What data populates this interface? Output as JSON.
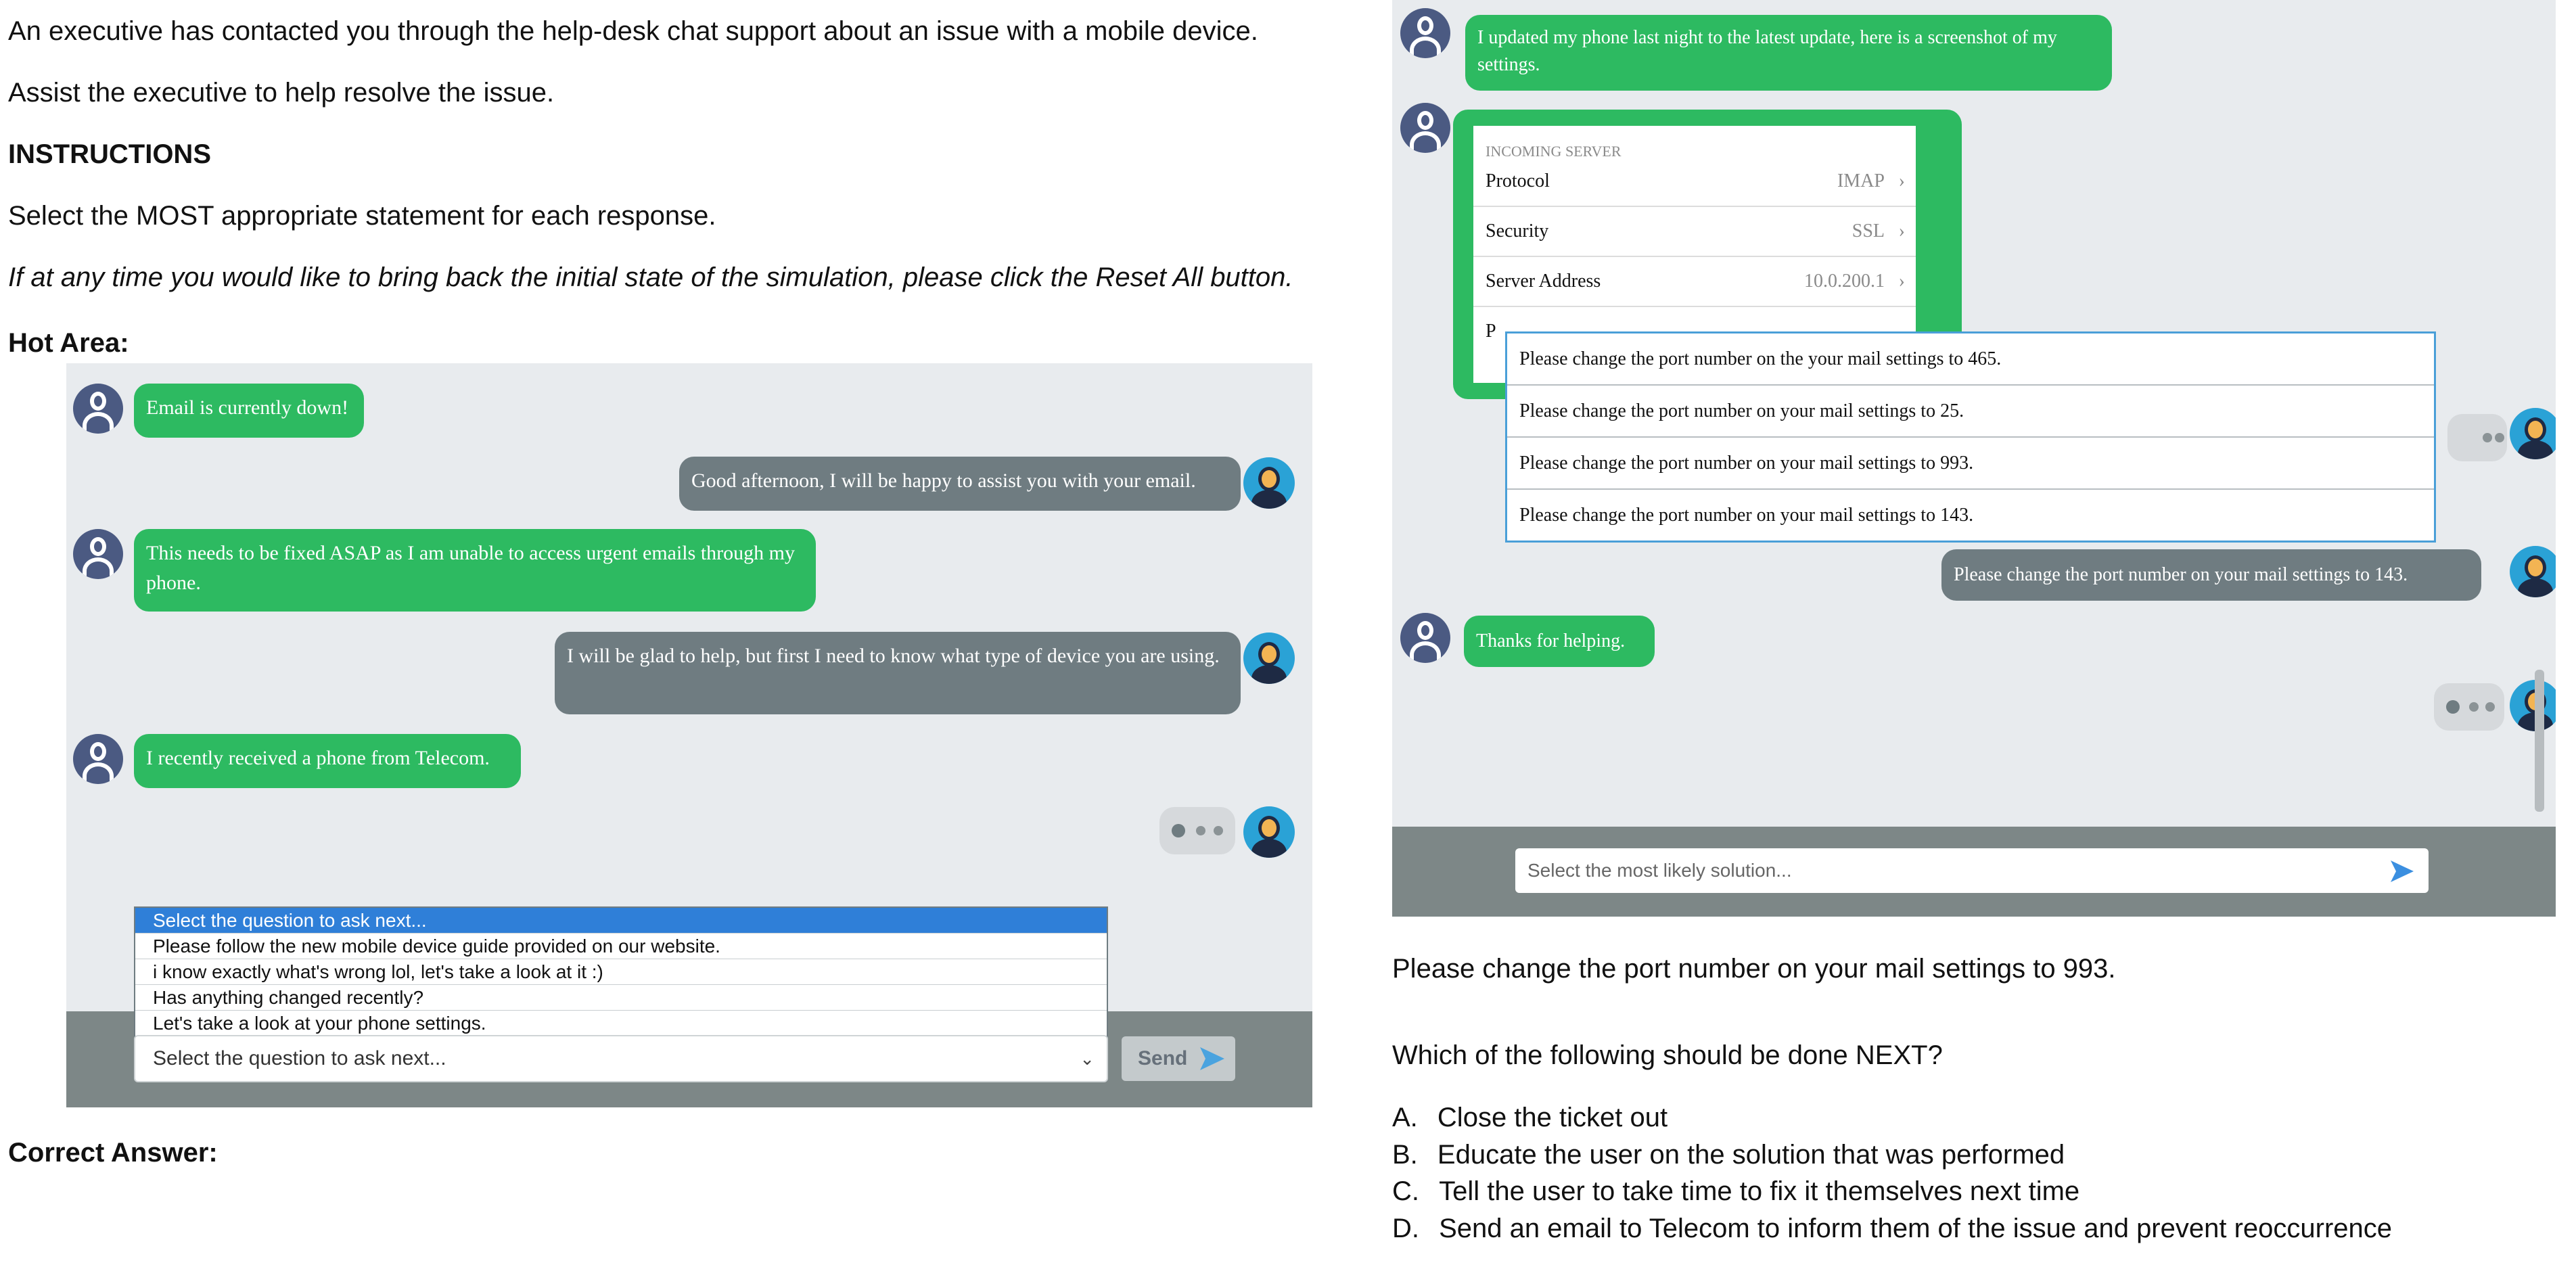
{
  "intro": {
    "line1": "An executive has contacted you through the help-desk chat support about an issue with a mobile device.",
    "line2": "Assist the executive to help resolve the issue.",
    "heading": "INSTRUCTIONS",
    "line3": "Select the MOST appropriate statement for each response.",
    "line4": "If at any time you would like to bring back the initial state of the simulation, please click the Reset All button.",
    "hot_area": "Hot Area:",
    "correct_answer": "Correct Answer:"
  },
  "left_chat": {
    "msg1": "Email is currently down!",
    "msg2": "Good afternoon, I will be happy to assist you with your email.",
    "msg3": "This needs to be fixed ASAP as I am unable to access urgent emails through my phone.",
    "msg4": "I will be glad to help, but first I need to know what type of device you are using.",
    "msg5": "I recently received a phone from Telecom.",
    "dropdown_options": [
      "Select the question to ask next...",
      "Please follow the new mobile device guide provided on our website.",
      "i know exactly what's wrong lol, let's take a look at it :)",
      "Has anything changed recently?",
      "Let's take a look at your phone settings."
    ],
    "select_value": "Select the question to ask next...",
    "send_label": "Send"
  },
  "right_chat": {
    "msg1": "I updated my phone last night to the latest update, here is a screenshot of my settings.",
    "settings": {
      "header": "INCOMING SERVER",
      "rows": [
        {
          "label": "Protocol",
          "value": "IMAP"
        },
        {
          "label": "Security",
          "value": "SSL"
        },
        {
          "label": "Server Address",
          "value": "10.0.200.1"
        }
      ],
      "truncated_label": "P"
    },
    "options": [
      "Please change the port number on the your mail settings to 465.",
      "Please change the port number on your mail settings to 25.",
      "Please change the port number on your mail settings to 993.",
      "Please change the port number on your mail settings to 143."
    ],
    "reply": "Please change the port number on your mail settings to 143.",
    "thanks": "Thanks for helping.",
    "input_placeholder": "Select the most likely solution..."
  },
  "question": {
    "answer_statement": "Please change the port number on your mail settings to 993.",
    "prompt": "Which of the following should be done NEXT?",
    "choices": [
      {
        "letter": "A.",
        "text": "Close the ticket out"
      },
      {
        "letter": "B.",
        "text": "Educate the user on the solution that was performed"
      },
      {
        "letter": "C.",
        "text": "Tell the user to take time to fix it themselves next time"
      },
      {
        "letter": "D.",
        "text": "Send an email to Telecom to inform them of the issue and prevent reoccurrence"
      }
    ]
  },
  "colors": {
    "user_bubble": "#2dba61",
    "agent_bubble": "#6f7c81",
    "highlight": "#2f7fd8",
    "border_blue": "#4a9fd8"
  }
}
